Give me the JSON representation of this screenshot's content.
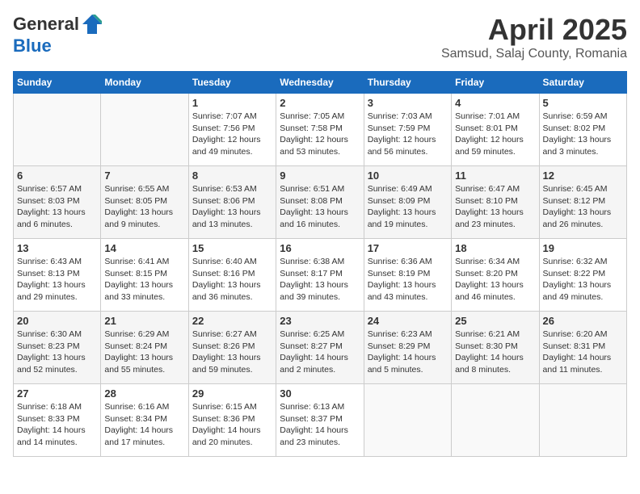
{
  "header": {
    "logo_general": "General",
    "logo_blue": "Blue",
    "month_title": "April 2025",
    "location": "Samsud, Salaj County, Romania"
  },
  "weekdays": [
    "Sunday",
    "Monday",
    "Tuesday",
    "Wednesday",
    "Thursday",
    "Friday",
    "Saturday"
  ],
  "weeks": [
    [
      {
        "day": "",
        "info": ""
      },
      {
        "day": "",
        "info": ""
      },
      {
        "day": "1",
        "info": "Sunrise: 7:07 AM\nSunset: 7:56 PM\nDaylight: 12 hours and 49 minutes."
      },
      {
        "day": "2",
        "info": "Sunrise: 7:05 AM\nSunset: 7:58 PM\nDaylight: 12 hours and 53 minutes."
      },
      {
        "day": "3",
        "info": "Sunrise: 7:03 AM\nSunset: 7:59 PM\nDaylight: 12 hours and 56 minutes."
      },
      {
        "day": "4",
        "info": "Sunrise: 7:01 AM\nSunset: 8:01 PM\nDaylight: 12 hours and 59 minutes."
      },
      {
        "day": "5",
        "info": "Sunrise: 6:59 AM\nSunset: 8:02 PM\nDaylight: 13 hours and 3 minutes."
      }
    ],
    [
      {
        "day": "6",
        "info": "Sunrise: 6:57 AM\nSunset: 8:03 PM\nDaylight: 13 hours and 6 minutes."
      },
      {
        "day": "7",
        "info": "Sunrise: 6:55 AM\nSunset: 8:05 PM\nDaylight: 13 hours and 9 minutes."
      },
      {
        "day": "8",
        "info": "Sunrise: 6:53 AM\nSunset: 8:06 PM\nDaylight: 13 hours and 13 minutes."
      },
      {
        "day": "9",
        "info": "Sunrise: 6:51 AM\nSunset: 8:08 PM\nDaylight: 13 hours and 16 minutes."
      },
      {
        "day": "10",
        "info": "Sunrise: 6:49 AM\nSunset: 8:09 PM\nDaylight: 13 hours and 19 minutes."
      },
      {
        "day": "11",
        "info": "Sunrise: 6:47 AM\nSunset: 8:10 PM\nDaylight: 13 hours and 23 minutes."
      },
      {
        "day": "12",
        "info": "Sunrise: 6:45 AM\nSunset: 8:12 PM\nDaylight: 13 hours and 26 minutes."
      }
    ],
    [
      {
        "day": "13",
        "info": "Sunrise: 6:43 AM\nSunset: 8:13 PM\nDaylight: 13 hours and 29 minutes."
      },
      {
        "day": "14",
        "info": "Sunrise: 6:41 AM\nSunset: 8:15 PM\nDaylight: 13 hours and 33 minutes."
      },
      {
        "day": "15",
        "info": "Sunrise: 6:40 AM\nSunset: 8:16 PM\nDaylight: 13 hours and 36 minutes."
      },
      {
        "day": "16",
        "info": "Sunrise: 6:38 AM\nSunset: 8:17 PM\nDaylight: 13 hours and 39 minutes."
      },
      {
        "day": "17",
        "info": "Sunrise: 6:36 AM\nSunset: 8:19 PM\nDaylight: 13 hours and 43 minutes."
      },
      {
        "day": "18",
        "info": "Sunrise: 6:34 AM\nSunset: 8:20 PM\nDaylight: 13 hours and 46 minutes."
      },
      {
        "day": "19",
        "info": "Sunrise: 6:32 AM\nSunset: 8:22 PM\nDaylight: 13 hours and 49 minutes."
      }
    ],
    [
      {
        "day": "20",
        "info": "Sunrise: 6:30 AM\nSunset: 8:23 PM\nDaylight: 13 hours and 52 minutes."
      },
      {
        "day": "21",
        "info": "Sunrise: 6:29 AM\nSunset: 8:24 PM\nDaylight: 13 hours and 55 minutes."
      },
      {
        "day": "22",
        "info": "Sunrise: 6:27 AM\nSunset: 8:26 PM\nDaylight: 13 hours and 59 minutes."
      },
      {
        "day": "23",
        "info": "Sunrise: 6:25 AM\nSunset: 8:27 PM\nDaylight: 14 hours and 2 minutes."
      },
      {
        "day": "24",
        "info": "Sunrise: 6:23 AM\nSunset: 8:29 PM\nDaylight: 14 hours and 5 minutes."
      },
      {
        "day": "25",
        "info": "Sunrise: 6:21 AM\nSunset: 8:30 PM\nDaylight: 14 hours and 8 minutes."
      },
      {
        "day": "26",
        "info": "Sunrise: 6:20 AM\nSunset: 8:31 PM\nDaylight: 14 hours and 11 minutes."
      }
    ],
    [
      {
        "day": "27",
        "info": "Sunrise: 6:18 AM\nSunset: 8:33 PM\nDaylight: 14 hours and 14 minutes."
      },
      {
        "day": "28",
        "info": "Sunrise: 6:16 AM\nSunset: 8:34 PM\nDaylight: 14 hours and 17 minutes."
      },
      {
        "day": "29",
        "info": "Sunrise: 6:15 AM\nSunset: 8:36 PM\nDaylight: 14 hours and 20 minutes."
      },
      {
        "day": "30",
        "info": "Sunrise: 6:13 AM\nSunset: 8:37 PM\nDaylight: 14 hours and 23 minutes."
      },
      {
        "day": "",
        "info": ""
      },
      {
        "day": "",
        "info": ""
      },
      {
        "day": "",
        "info": ""
      }
    ]
  ]
}
